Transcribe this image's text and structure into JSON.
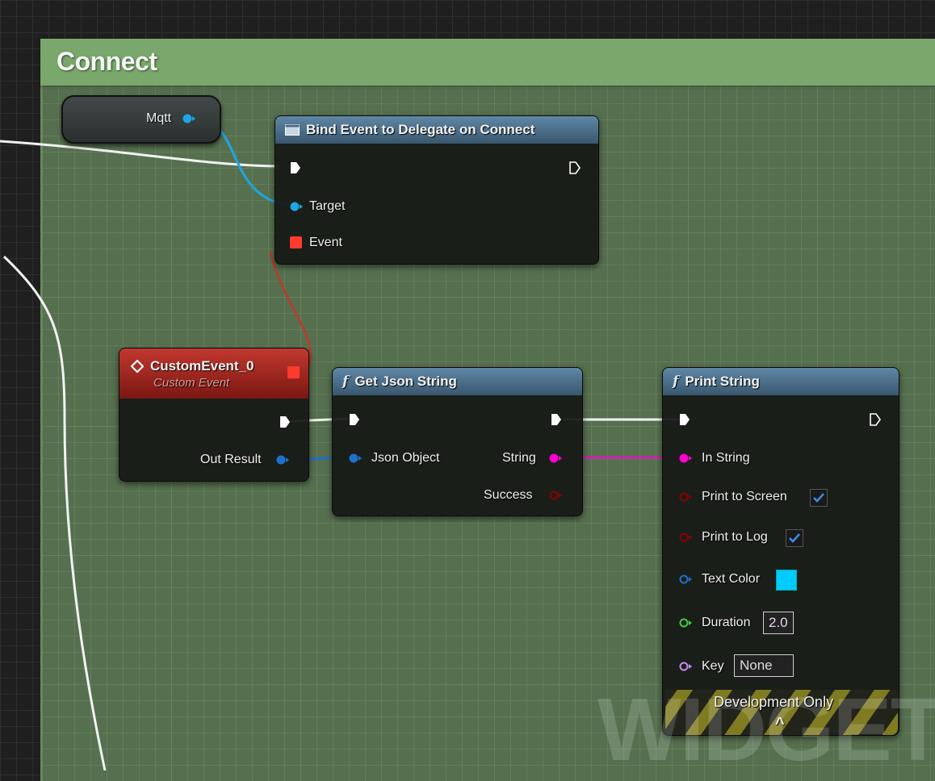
{
  "comment": {
    "title": "Connect"
  },
  "variable_node": {
    "label": "Mqtt",
    "pin_color": "#1ea5e6"
  },
  "bind_node": {
    "title": "Bind Event to Delegate on Connect",
    "icon": "delegate-icon",
    "pins": {
      "target": "Target",
      "event": "Event"
    }
  },
  "custom_event_node": {
    "title": "CustomEvent_0",
    "subtitle": "Custom Event",
    "icon": "event-diamond-icon",
    "pins": {
      "out_result": "Out Result"
    }
  },
  "get_json_node": {
    "title": "Get Json String",
    "icon": "function-icon",
    "pins": {
      "json_object": "Json Object",
      "string": "String",
      "success": "Success"
    }
  },
  "print_node": {
    "title": "Print String",
    "icon": "function-icon",
    "pins": {
      "in_string": "In String",
      "print_to_screen": "Print to Screen",
      "print_to_log": "Print to Log",
      "text_color": "Text Color",
      "duration": "Duration",
      "key": "Key"
    },
    "values": {
      "duration": "2.0",
      "key": "None",
      "print_to_screen": true,
      "print_to_log": true,
      "text_color": "#00ccff"
    },
    "dev_only": "Development Only",
    "expand_glyph": "^"
  },
  "watermark": "WIDGET",
  "colors": {
    "exec": "#ffffff",
    "object": "#1ea5e6",
    "delegate": "#ff3b30",
    "string": "#ff00d0",
    "bool": "#8b0000",
    "struct": "#1f6fcf",
    "float": "#3fcf3f",
    "name": "#c88cf0"
  }
}
